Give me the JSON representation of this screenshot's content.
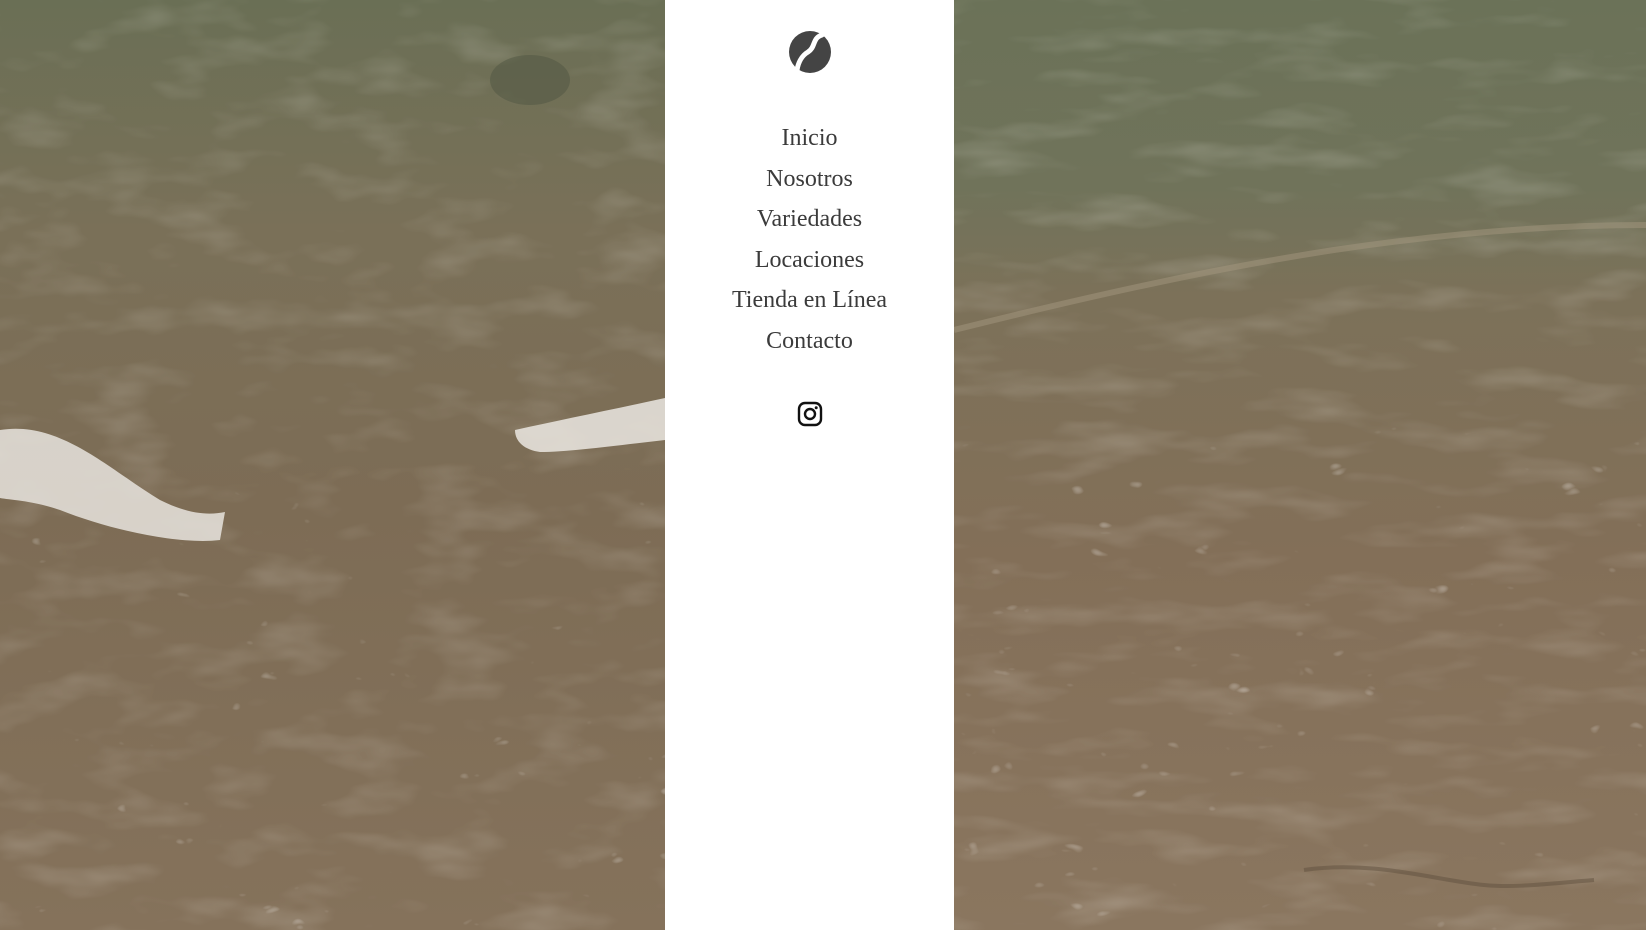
{
  "brand": {
    "logo_icon": "coffee-bean-icon"
  },
  "nav": {
    "items": [
      {
        "label": "Inicio"
      },
      {
        "label": "Nosotros"
      },
      {
        "label": "Variedades"
      },
      {
        "label": "Locaciones"
      },
      {
        "label": "Tienda en Línea"
      },
      {
        "label": "Contacto"
      }
    ]
  },
  "social": {
    "icon": "instagram-icon"
  },
  "colors": {
    "panel_bg": "#ffffff",
    "nav_text": "#3b3b3b",
    "logo": "#444444",
    "sand": "#7f6f58",
    "water": "#6f735a"
  },
  "background": {
    "subject": "aerial-beach-waves-video"
  }
}
